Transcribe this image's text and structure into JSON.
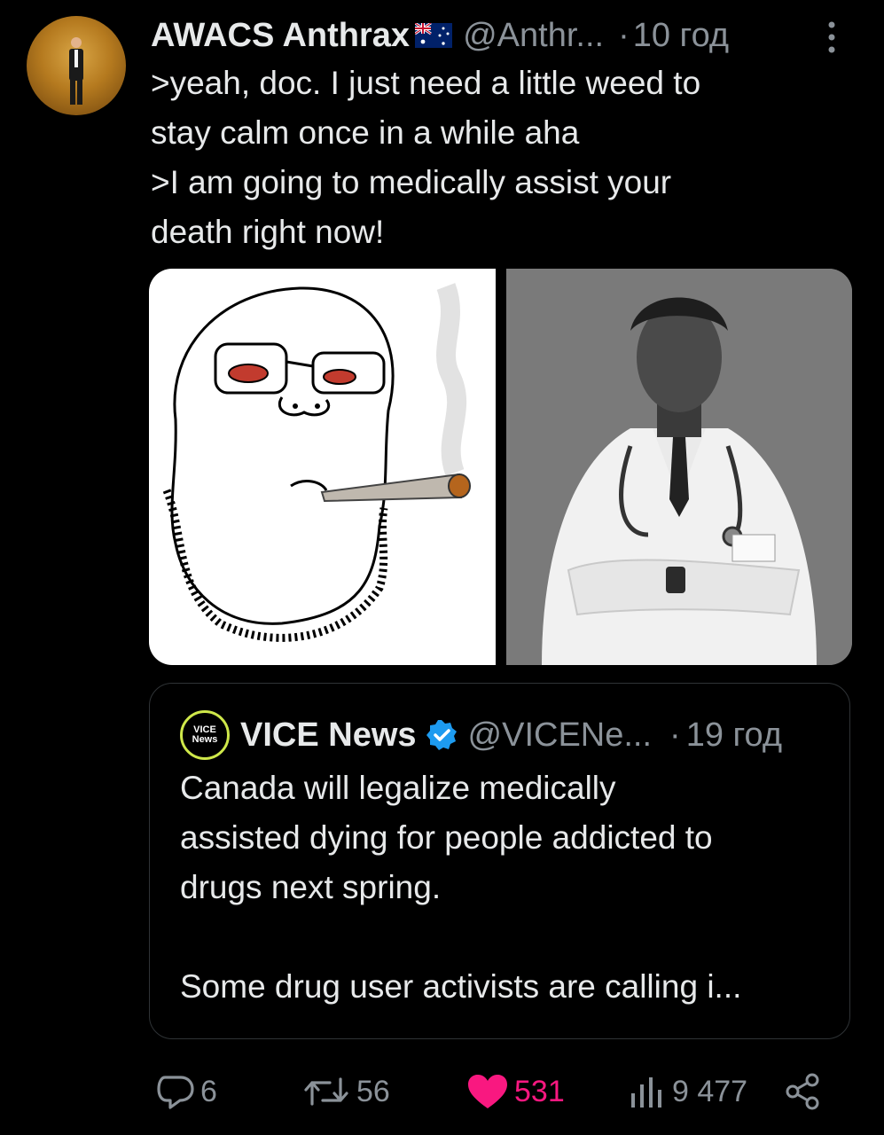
{
  "tweet": {
    "author_name": "AWACS Anthrax",
    "handle": "@Anthr...",
    "separator": "·",
    "time": "10 год",
    "flag": "australia-flag",
    "text_lines": [
      ">yeah, doc. I just need a little weed to",
      "stay calm once in a while aha",
      ">I am going to medically assist your",
      "death right now!"
    ]
  },
  "media": [
    {
      "description": "wojak-smoking-joint-image"
    },
    {
      "description": "doctor-gigachad-image"
    }
  ],
  "quote": {
    "logo_text_top": "VICE",
    "logo_text_bottom": "News",
    "author_name": "VICE News",
    "handle": "@VICENe...",
    "separator": "·",
    "time": "19 год",
    "text_lines": [
      "Canada will legalize medically",
      "assisted dying for people addicted to",
      "drugs next spring.",
      "",
      "Some drug user activists are calling i..."
    ]
  },
  "actions": {
    "replies": "6",
    "retweets": "56",
    "likes": "531",
    "views": "9 477"
  },
  "colors": {
    "background": "#000000",
    "text": "#e7e9ea",
    "muted": "#8b9299",
    "like": "#f91880",
    "verified": "#1d9bf0",
    "border": "#2f3336"
  }
}
